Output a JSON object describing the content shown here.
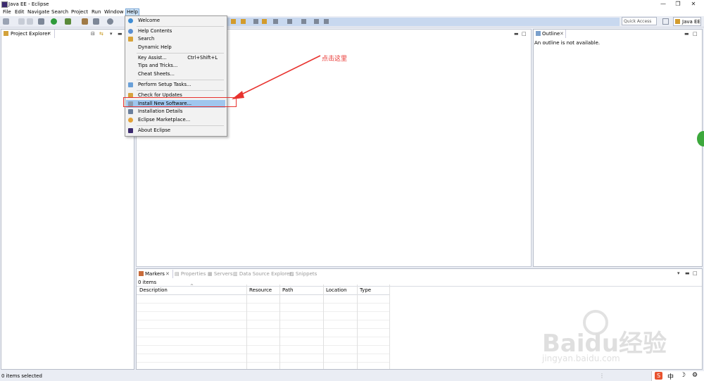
{
  "window": {
    "title": "Java EE - Eclipse",
    "minimize": "—",
    "restore": "❐",
    "close": "✕"
  },
  "menubar": [
    "File",
    "Edit",
    "Navigate",
    "Search",
    "Project",
    "Run",
    "Window",
    "Help"
  ],
  "quick_access": {
    "placeholder": "Quick Access"
  },
  "perspective": {
    "label": "Java EE"
  },
  "project_explorer": {
    "title": "Project Explorer"
  },
  "outline": {
    "title": "Outline",
    "message": "An outline is not available."
  },
  "help_menu": {
    "items": [
      {
        "label": "Welcome",
        "shortcut": ""
      },
      {
        "label": "Help Contents",
        "shortcut": ""
      },
      {
        "label": "Search",
        "shortcut": ""
      },
      {
        "label": "Dynamic Help",
        "shortcut": ""
      },
      {
        "label": "Key Assist...",
        "shortcut": "Ctrl+Shift+L"
      },
      {
        "label": "Tips and Tricks...",
        "shortcut": ""
      },
      {
        "label": "Cheat Sheets...",
        "shortcut": ""
      },
      {
        "label": "Perform Setup Tasks...",
        "shortcut": ""
      },
      {
        "label": "Check for Updates",
        "shortcut": ""
      },
      {
        "label": "Install New Software...",
        "shortcut": ""
      },
      {
        "label": "Installation Details",
        "shortcut": ""
      },
      {
        "label": "Eclipse Marketplace...",
        "shortcut": ""
      },
      {
        "label": "About Eclipse",
        "shortcut": ""
      }
    ]
  },
  "annotation": {
    "text": "点击这里",
    "color": "#e8322e"
  },
  "bottom_tabs": [
    "Markers",
    "Properties",
    "Servers",
    "Data Source Explorer",
    "Snippets"
  ],
  "markers": {
    "count": "0 items",
    "columns": [
      "Description",
      "Resource",
      "Path",
      "Location",
      "Type"
    ]
  },
  "status": {
    "text": "0 items selected"
  },
  "watermark": {
    "brand": "Baidu经验",
    "url": "jingyan.baidu.com"
  },
  "taskbar_icons": [
    "S",
    "中",
    "☽",
    "⚙"
  ],
  "colors": {
    "accent": "#9fc6ee",
    "annotation_red": "#e8322e",
    "toolbar_blue": "#c8d8ef"
  }
}
